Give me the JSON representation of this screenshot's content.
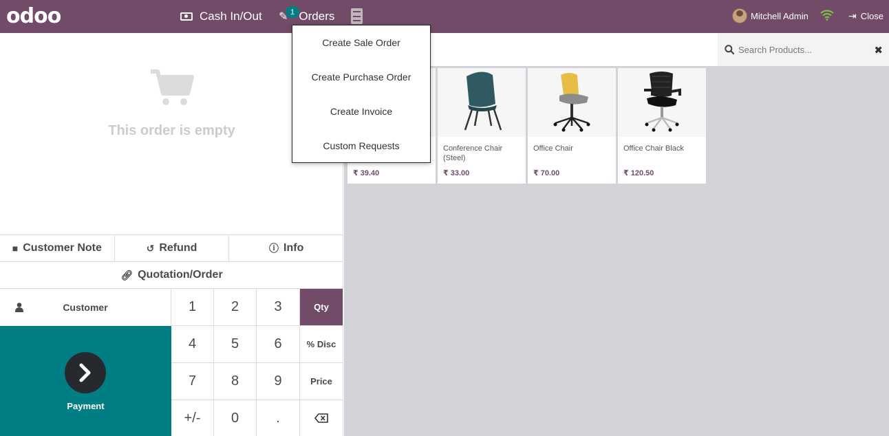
{
  "topbar": {
    "logo": "odoo",
    "cash_label": "Cash In/Out",
    "orders_label": "Orders",
    "orders_badge": "1",
    "user_name": "Mitchell Admin",
    "close_label": "Close"
  },
  "orders_menu": {
    "items": [
      {
        "label": "Create Sale Order"
      },
      {
        "label": "Create Purchase Order"
      },
      {
        "label": "Create Invoice"
      },
      {
        "label": "Custom Requests"
      }
    ]
  },
  "order": {
    "empty_text": "This order is empty"
  },
  "controls": {
    "customer_note": "Customer Note",
    "refund": "Refund",
    "info": "Info",
    "quotation": "Quotation/Order",
    "customer": "Customer",
    "payment": "Payment"
  },
  "numpad": {
    "keys": [
      "1",
      "2",
      "3",
      "Qty",
      "4",
      "5",
      "6",
      "% Disc",
      "7",
      "8",
      "9",
      "Price",
      "+/-",
      "0",
      ".",
      ""
    ],
    "active_mode": "Qty"
  },
  "search": {
    "placeholder": "Search Products..."
  },
  "products": [
    {
      "name": "",
      "price": "₹ 39.40"
    },
    {
      "name": "Conference Chair (Steel)",
      "price": "₹ 33.00"
    },
    {
      "name": "Office Chair",
      "price": "₹ 70.00"
    },
    {
      "name": "Office Chair Black",
      "price": "₹ 120.50"
    }
  ],
  "colors": {
    "brand": "#714b67",
    "teal": "#017e84"
  }
}
